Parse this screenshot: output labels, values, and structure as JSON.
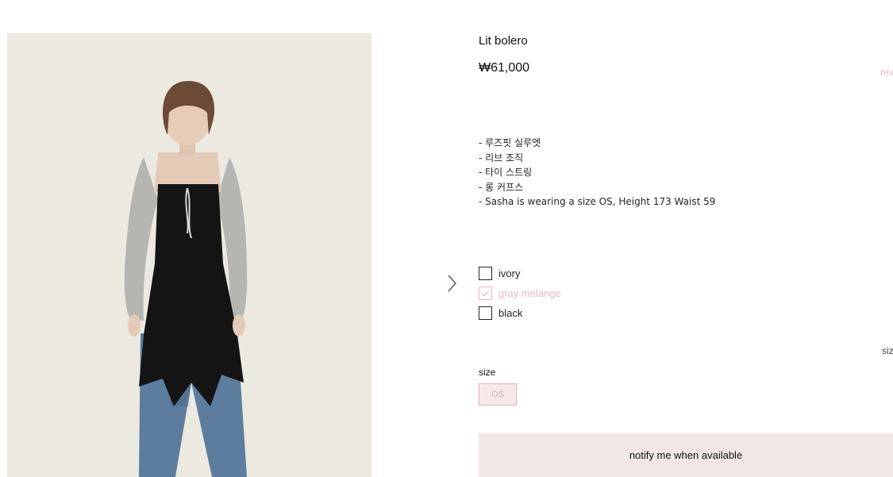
{
  "product": {
    "name": "Lit bolero",
    "price": "₩61,000",
    "reviews_label": "rev",
    "image_alt": "model wearing gray melange bolero over black corset dress and jeans"
  },
  "description": [
    "- 루즈핏 실루엣",
    "- 리브 조직",
    "- 타이 스트링",
    "- 롱 커프스",
    "- Sasha is wearing a size OS, Height 173 Waist 59"
  ],
  "colors": [
    {
      "label": "ivory",
      "checked": false
    },
    {
      "label": "gray melange",
      "checked": true
    },
    {
      "label": "black",
      "checked": false
    }
  ],
  "size": {
    "label": "size",
    "option": "OS",
    "guide_label": "siz"
  },
  "notify_label": "notify me when available",
  "theme": {
    "accent_pink": "#e9b7bd",
    "button_bg": "#f3e6e6",
    "photo_bg": "#ece9e1"
  }
}
